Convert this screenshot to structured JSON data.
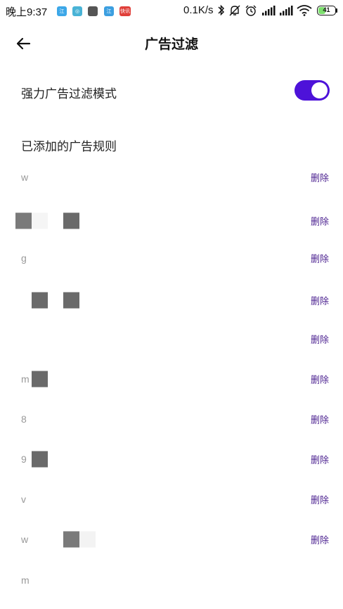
{
  "status_bar": {
    "time": "晚上9:37",
    "notifications": [
      {
        "name": "notif-app-1",
        "color": "#3ca7e8",
        "text": "江"
      },
      {
        "name": "notif-app-2",
        "color": "#49b3d6",
        "text": "◎"
      },
      {
        "name": "notif-app-3",
        "color": "#555555",
        "text": ""
      },
      {
        "name": "notif-app-4",
        "color": "#3c9fe0",
        "text": "江"
      },
      {
        "name": "notif-app-5",
        "color": "#e0403a",
        "text": "快讯"
      }
    ],
    "network_speed": "0.1K/s",
    "battery": "41",
    "battery_level": 0.41,
    "icons": [
      "bluetooth-icon",
      "mute-icon",
      "alarm-icon",
      "signal-icon",
      "signal-icon",
      "wifi-icon",
      "battery-icon"
    ]
  },
  "header": {
    "title": "广告过滤",
    "back_icon": "arrow-left-icon"
  },
  "settings": {
    "strong_mode_label": "强力广告过滤模式",
    "strong_mode_enabled": true,
    "accent_color": "#4d12d9"
  },
  "rules_section": {
    "label": "已添加的广告规则",
    "delete_label": "删除",
    "delete_color": "#4a1f8f",
    "items": [
      {
        "text": "w",
        "delete": "删除"
      },
      {
        "text": "",
        "delete": "删除"
      },
      {
        "text": "g",
        "delete": "删除"
      },
      {
        "text": "",
        "delete": "删除"
      },
      {
        "text": "",
        "delete": "删除"
      },
      {
        "text": "m",
        "delete": "删除"
      },
      {
        "text": "8",
        "delete": "删除"
      },
      {
        "text": "9",
        "delete": "删除"
      },
      {
        "text": "v",
        "delete": "删除"
      },
      {
        "text": "w",
        "delete": "删除"
      },
      {
        "text": "m",
        "delete": ""
      }
    ]
  }
}
